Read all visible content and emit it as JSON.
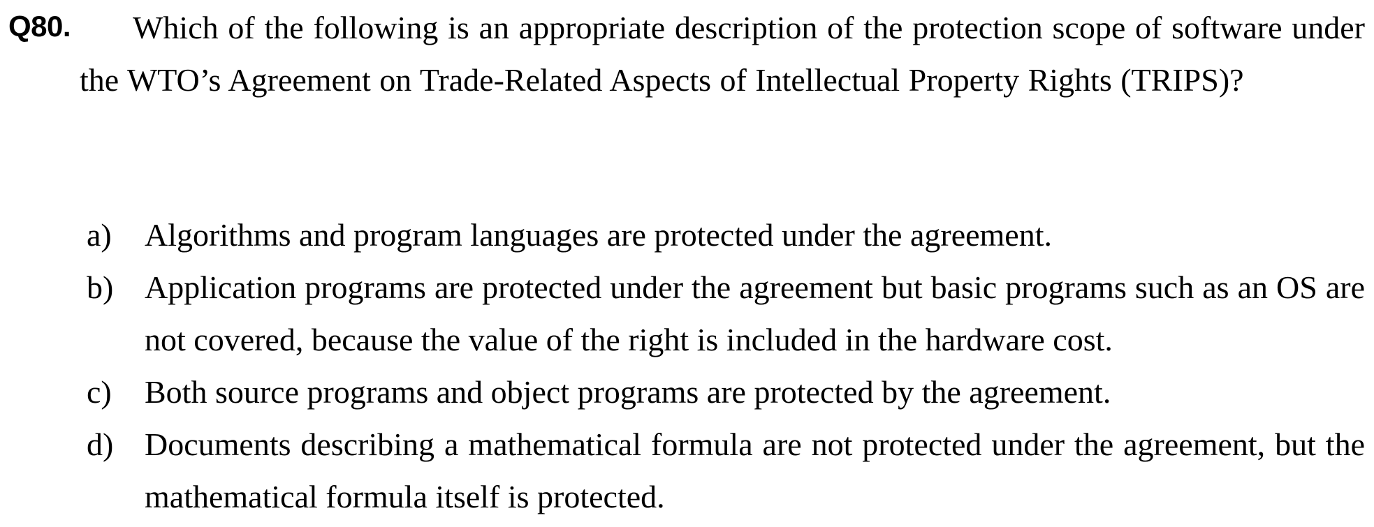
{
  "question": {
    "number": "Q80.",
    "text": "Which of the following is an appropriate description of the protection scope of software under the WTO’s Agreement on Trade-Related Aspects of Intellectual Property Rights (TRIPS)?"
  },
  "options": [
    {
      "letter": "a)",
      "text": "Algorithms and program languages are protected under the agreement."
    },
    {
      "letter": "b)",
      "text": "Application programs are protected under the agreement but basic programs such as an OS are not covered, because the value of the right is included in the hardware cost."
    },
    {
      "letter": "c)",
      "text": "Both source programs and object programs are protected by the agreement."
    },
    {
      "letter": "d)",
      "text": "Documents describing a mathematical formula are not protected under the agreement, but the mathematical formula itself is protected."
    }
  ]
}
